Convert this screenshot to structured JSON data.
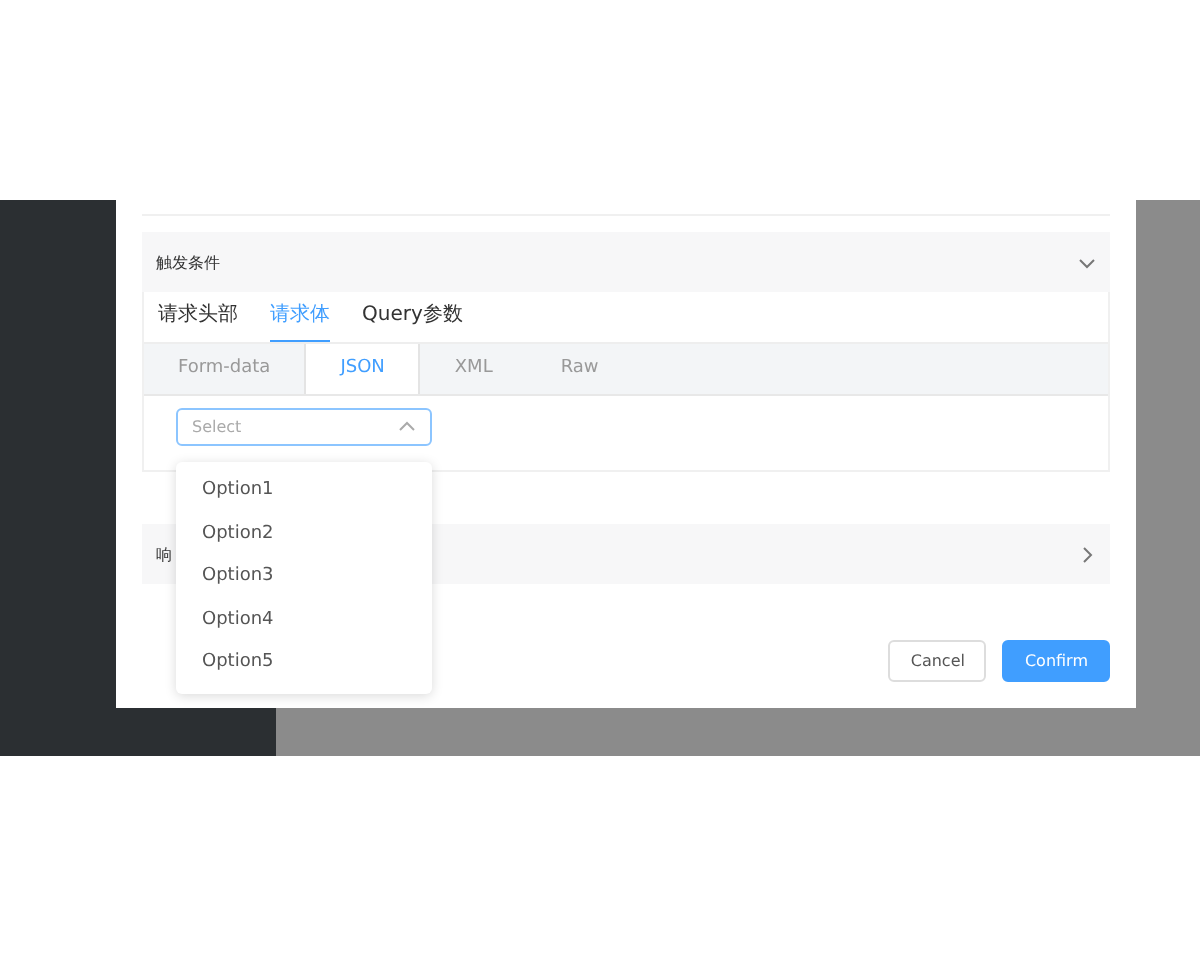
{
  "sections": [
    {
      "title": "触发条件",
      "expanded": true
    },
    {
      "title": "响",
      "expanded": false
    }
  ],
  "request_tabs": [
    {
      "label": "请求头部",
      "selected": false
    },
    {
      "label": "请求体",
      "selected": true
    },
    {
      "label": "Query参数",
      "selected": false
    }
  ],
  "body_tabs": [
    {
      "label": "Form-data",
      "selected": false
    },
    {
      "label": "JSON",
      "selected": true
    },
    {
      "label": "XML",
      "selected": false
    },
    {
      "label": "Raw",
      "selected": false
    }
  ],
  "select": {
    "placeholder": "Select",
    "open": true
  },
  "options": [
    "Option1",
    "Option2",
    "Option3",
    "Option4",
    "Option5"
  ],
  "buttons": [
    {
      "label": "Cancel",
      "kind": "default"
    },
    {
      "label": "Confirm",
      "kind": "primary"
    }
  ]
}
